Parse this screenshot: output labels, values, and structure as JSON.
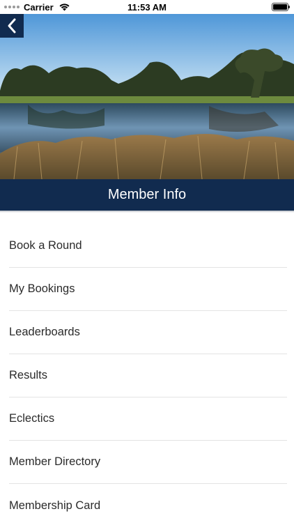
{
  "status_bar": {
    "carrier": "Carrier",
    "time": "11:53 AM"
  },
  "header": {
    "title": "Member Info"
  },
  "menu": {
    "items": [
      {
        "label": "Book a Round"
      },
      {
        "label": "My Bookings"
      },
      {
        "label": "Leaderboards"
      },
      {
        "label": "Results"
      },
      {
        "label": "Eclectics"
      },
      {
        "label": "Member Directory"
      },
      {
        "label": "Membership Card"
      }
    ]
  },
  "colors": {
    "navy": "#112b4f",
    "divider": "#e3e3e3",
    "text": "#2b2b2b"
  },
  "icons": {
    "back": "chevron-left-icon",
    "wifi": "wifi-icon",
    "battery": "battery-icon"
  }
}
